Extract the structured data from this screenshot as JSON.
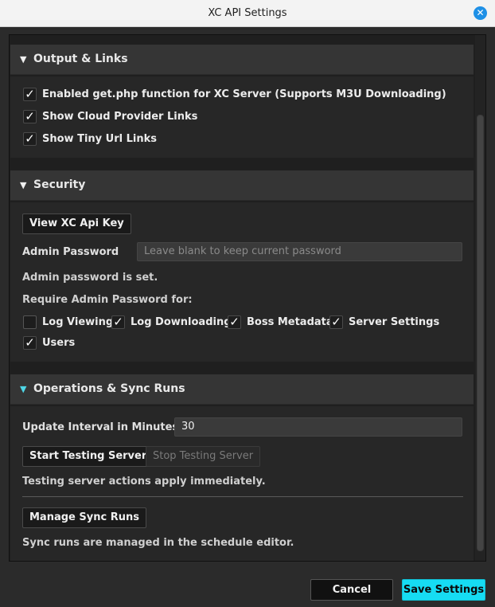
{
  "window": {
    "title": "XC API Settings",
    "close_icon": "close-icon"
  },
  "sections": {
    "output": {
      "title": "Output & Links",
      "expanded": true,
      "options": [
        {
          "label": "Enabled get.php function for XC Server (Supports M3U Downloading)",
          "checked": true
        },
        {
          "label": "Show Cloud Provider Links",
          "checked": true
        },
        {
          "label": "Show Tiny Url Links",
          "checked": true
        }
      ]
    },
    "security": {
      "title": "Security",
      "expanded": true,
      "view_key_button": "View XC Api Key",
      "admin_password_label": "Admin Password",
      "admin_password_placeholder": "Leave blank to keep current password",
      "admin_password_value": "",
      "password_status": "Admin password is set.",
      "require_label": "Require Admin Password for:",
      "require_options": [
        {
          "label": "Log Viewing",
          "checked": false
        },
        {
          "label": "Log Downloading",
          "checked": true
        },
        {
          "label": "Boss Metadata",
          "checked": true
        },
        {
          "label": "Server Settings",
          "checked": true
        },
        {
          "label": "Users",
          "checked": true
        }
      ]
    },
    "operations": {
      "title": "Operations & Sync Runs",
      "expanded": true,
      "interval_label": "Update Interval in Minutes",
      "interval_value": "30",
      "start_button": "Start Testing Server",
      "stop_button": "Stop Testing Server",
      "testing_note": "Testing server actions apply immediately.",
      "manage_button": "Manage Sync Runs",
      "sync_note": "Sync runs are managed in the schedule editor."
    }
  },
  "footer": {
    "cancel_label": "Cancel",
    "save_label": "Save Settings"
  },
  "colors": {
    "accent": "#16dcf3",
    "expand_arrow_active": "#4fd6e6",
    "close_button": "#1e90e6"
  }
}
